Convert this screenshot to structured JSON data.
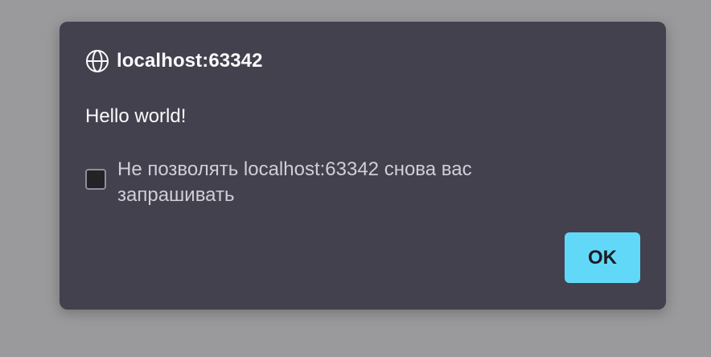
{
  "dialog": {
    "origin": "localhost:63342",
    "origin_icon": "globe-icon",
    "message": "Hello world!",
    "checkbox_label": "Не позволять localhost:63342 снова вас запрашивать",
    "checkbox_checked": false,
    "ok_label": "OK"
  },
  "colors": {
    "backdrop": "#9a9a9c",
    "dialog_bg": "#42414d",
    "accent": "#61d8f8",
    "text": "#fbfbfe"
  }
}
